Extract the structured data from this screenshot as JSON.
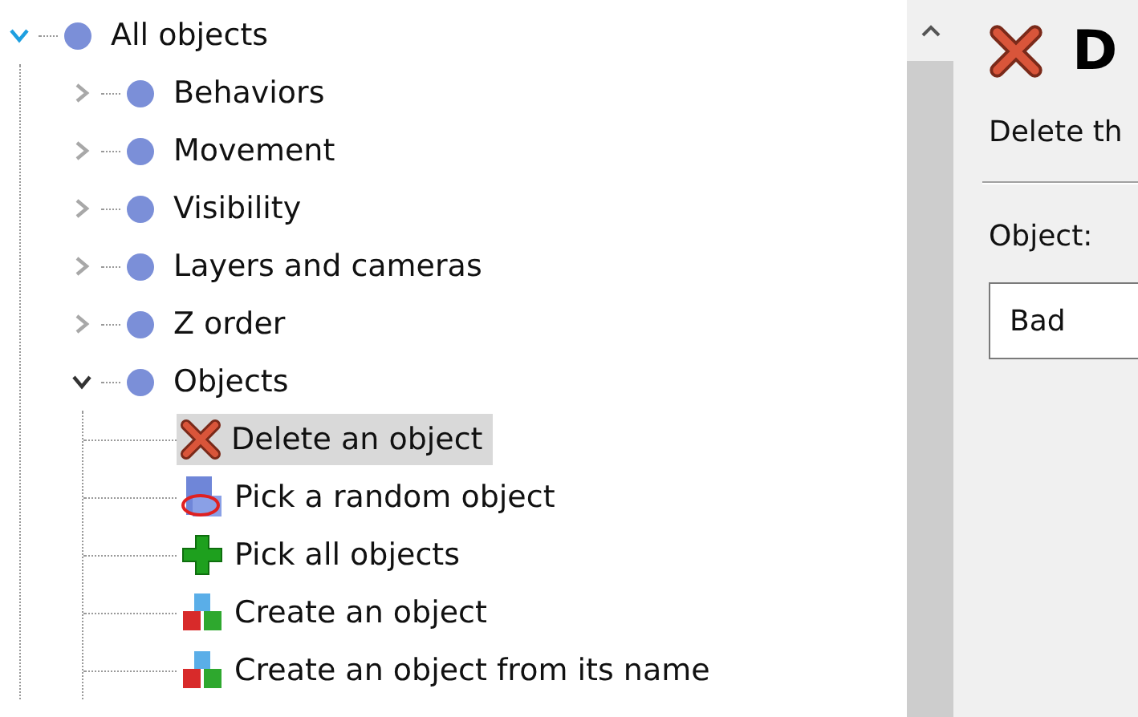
{
  "tree": [
    {
      "label": "All objects",
      "expanded": true,
      "hot": true,
      "selected": false,
      "children": [
        {
          "label": "Behaviors",
          "expanded": false,
          "hot": false,
          "selected": false
        },
        {
          "label": "Movement",
          "expanded": false,
          "hot": false,
          "selected": false
        },
        {
          "label": "Visibility",
          "expanded": false,
          "hot": false,
          "selected": false
        },
        {
          "label": "Layers and cameras",
          "expanded": false,
          "hot": false,
          "selected": false
        },
        {
          "label": "Z order",
          "expanded": false,
          "hot": false,
          "selected": false
        },
        {
          "label": "Objects",
          "expanded": true,
          "hot": false,
          "selected": false,
          "children": [
            {
              "label": "Delete an object",
              "kind": "delete",
              "selected": true
            },
            {
              "label": "Pick a random object",
              "kind": "random",
              "selected": false
            },
            {
              "label": "Pick all objects",
              "kind": "add",
              "selected": false
            },
            {
              "label": "Create an object",
              "kind": "create",
              "selected": false
            },
            {
              "label": "Create an object from its name",
              "kind": "create",
              "selected": false
            }
          ]
        }
      ]
    }
  ],
  "panel": {
    "title": "D",
    "description": "Delete th",
    "field_label": "Object:",
    "field_value": "Bad"
  }
}
